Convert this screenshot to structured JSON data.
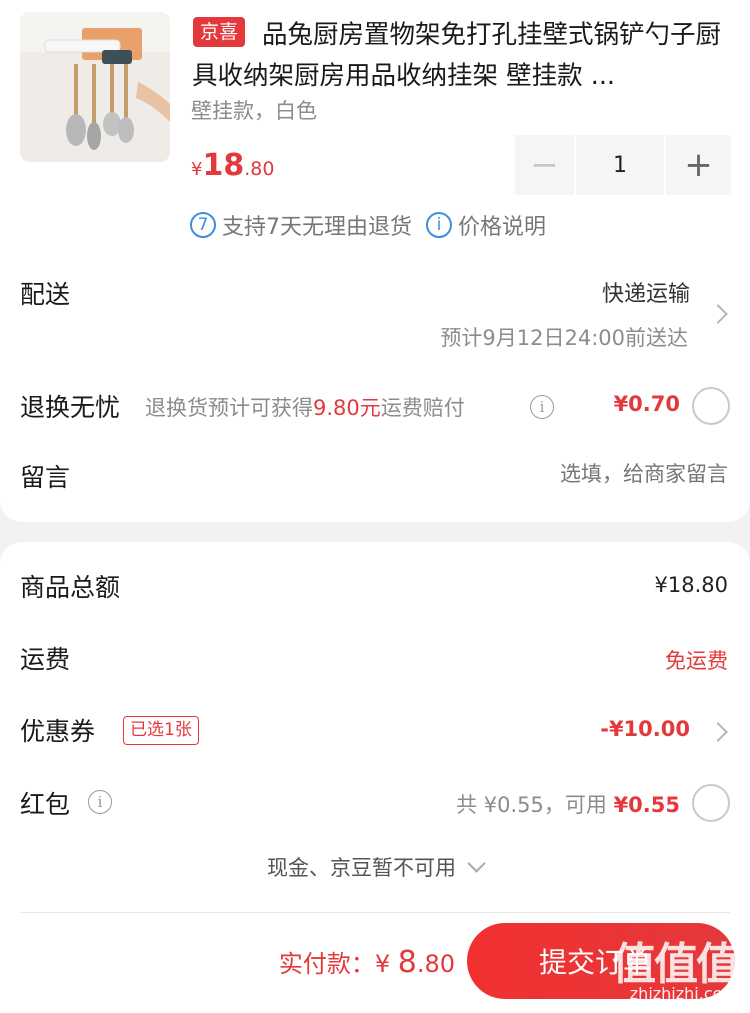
{
  "product": {
    "badge": "京喜",
    "title": "品兔厨房置物架免打孔挂壁式锅铲勺子厨具收纳架厨房用品收纳挂架 壁挂款 ...",
    "spec": "壁挂款，白色",
    "price_yen": "¥",
    "price_int": "18",
    "price_dec": ".80",
    "quantity": "1",
    "minus": "−",
    "plus": "+",
    "service_return_icon": "7",
    "service_return": "支持7天无理由退货",
    "service_price_icon": "i",
    "service_price": "价格说明"
  },
  "delivery": {
    "label": "配送",
    "method": "快递运输",
    "eta": "预计9月12日24:00前送达"
  },
  "returns": {
    "label": "退换无忧",
    "desc_prefix": "退换货预计可获得",
    "desc_amount": "9.80元",
    "desc_suffix": "运费赔付",
    "price": "¥0.70"
  },
  "note": {
    "label": "留言",
    "placeholder": "选填，给商家留言"
  },
  "summary": {
    "total_label": "商品总额",
    "total_value": "¥18.80",
    "shipping_label": "运费",
    "shipping_value": "免运费",
    "coupon_label": "优惠券",
    "coupon_tag": "已选1张",
    "coupon_value": "-¥10.00",
    "redpack_label": "红包",
    "redpack_total": "共 ¥0.55，可用 ",
    "redpack_available": "¥0.55",
    "unavailable": "现金、京豆暂不可用"
  },
  "footer": {
    "pay_label": "实付款：",
    "pay_yen": "¥ ",
    "pay_int": "8",
    "pay_dec": ".80",
    "submit": "提交订单",
    "watermark": "值值值",
    "watermark_url": "zhizhizhi.com"
  },
  "colors": {
    "accent": "#e4393c",
    "info_blue": "#3e8ee0"
  }
}
